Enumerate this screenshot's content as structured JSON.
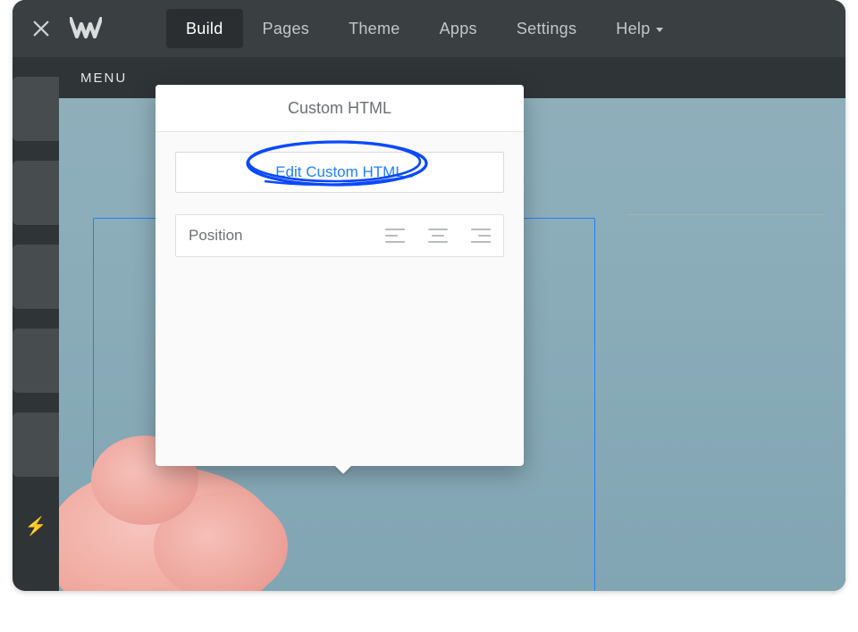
{
  "topnav": {
    "tabs": [
      "Build",
      "Pages",
      "Theme",
      "Apps",
      "Settings",
      "Help"
    ],
    "active_tab": "Build"
  },
  "subbar": {
    "menu_label": "MENU"
  },
  "popover": {
    "title": "Custom HTML",
    "edit_button": "Edit Custom HTML",
    "position_label": "Position"
  },
  "colors": {
    "accent": "#1f80ff",
    "topbar": "#3a3f42",
    "window": "#2f3437"
  }
}
